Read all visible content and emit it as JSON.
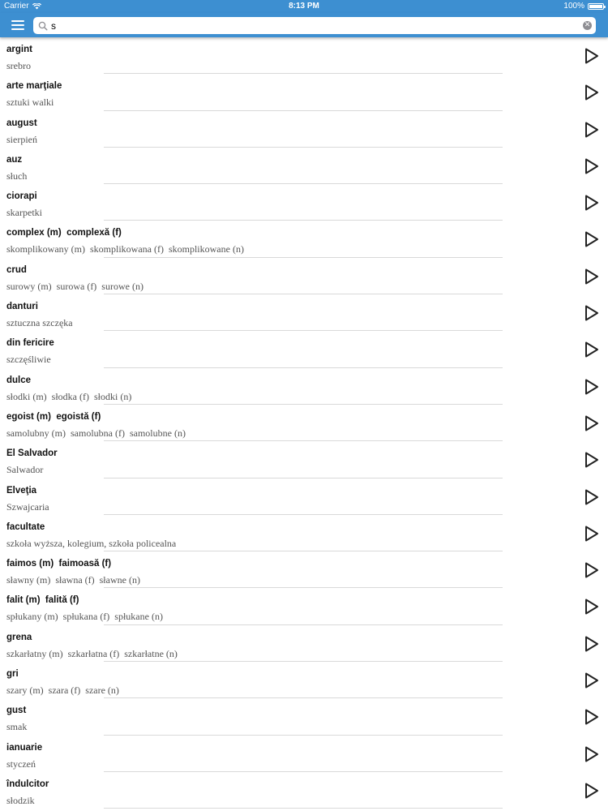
{
  "status_bar": {
    "carrier": "Carrier",
    "time": "8:13 PM",
    "battery": "100%"
  },
  "search": {
    "value": "s",
    "placeholder": ""
  },
  "entries": [
    {
      "term": "argint",
      "translation": "srebro"
    },
    {
      "term": "arte marţiale",
      "translation": "sztuki walki"
    },
    {
      "term": "august",
      "translation": "sierpień"
    },
    {
      "term": "auz",
      "translation": "słuch"
    },
    {
      "term": "ciorapi",
      "translation": "skarpetki"
    },
    {
      "term": "complex (m)  complexă (f)",
      "translation": "skomplikowany (m)  skomplikowana (f)  skomplikowane (n)"
    },
    {
      "term": "crud",
      "translation": "surowy (m)  surowa (f)  surowe (n)"
    },
    {
      "term": "danturi",
      "translation": "sztuczna szczęka"
    },
    {
      "term": "din fericire",
      "translation": "szczęśliwie"
    },
    {
      "term": "dulce",
      "translation": "słodki (m)  słodka (f)  słodki (n)"
    },
    {
      "term": "egoist (m)  egoistă (f)",
      "translation": "samolubny (m)  samolubna (f)  samolubne (n)"
    },
    {
      "term": "El Salvador",
      "translation": "Salwador"
    },
    {
      "term": "Elveţia",
      "translation": "Szwajcaria"
    },
    {
      "term": "facultate",
      "translation": "szkoła wyższa, kolegium, szkoła policealna"
    },
    {
      "term": "faimos (m)  faimoasă (f)",
      "translation": "sławny (m)  sławna (f)  sławne (n)"
    },
    {
      "term": "falit (m)  falită (f)",
      "translation": "spłukany (m)  spłukana (f)  spłukane (n)"
    },
    {
      "term": "grena",
      "translation": "szkarłatny (m)  szkarłatna (f)  szkarłatne (n)"
    },
    {
      "term": "gri",
      "translation": "szary (m)  szara (f)  szare (n)"
    },
    {
      "term": "gust",
      "translation": "smak"
    },
    {
      "term": "ianuarie",
      "translation": "styczeń"
    },
    {
      "term": "îndulcitor",
      "translation": "słodzik"
    }
  ],
  "icons": {
    "menu": "menu-icon",
    "search": "search-icon",
    "clear": "clear-icon",
    "play": "play-icon",
    "wifi": "wifi-icon",
    "battery": "battery-icon"
  },
  "colors": {
    "nav_bar": "#3d8fd1",
    "divider": "#d9d9d9",
    "term_text": "#111111",
    "translation_text": "#555555"
  }
}
